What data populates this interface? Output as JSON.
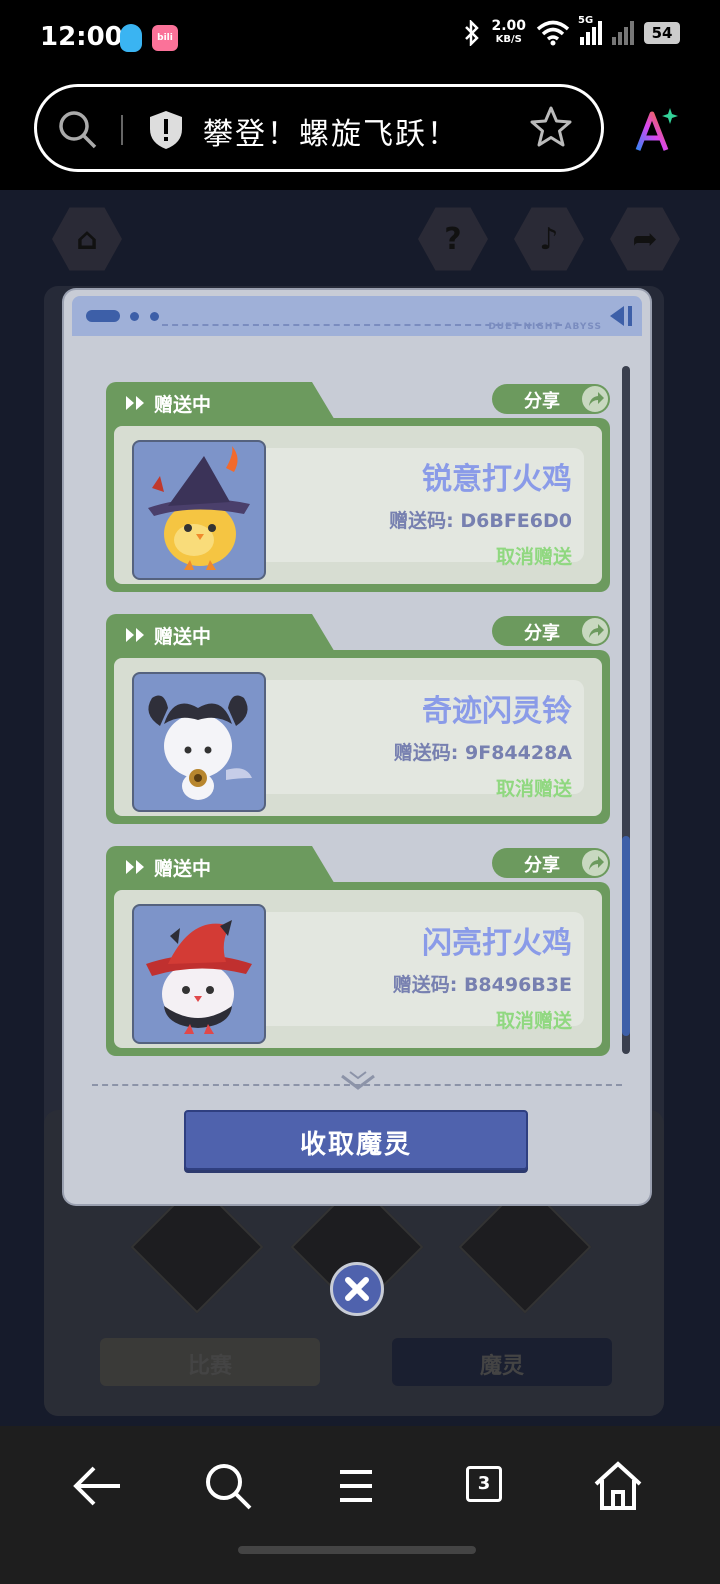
{
  "status_bar": {
    "time": "12:00",
    "net_speed_value": "2.00",
    "net_speed_unit": "KB/S",
    "network_type": "5G",
    "battery": "54"
  },
  "browser": {
    "page_title": "攀登！螺旋飞跃！"
  },
  "game_background": {
    "tab_left": "比赛",
    "tab_right": "魔灵"
  },
  "modal": {
    "brand": "DUET NIGHT ABYSS",
    "cards": [
      {
        "status": "赠送中",
        "share_label": "分享",
        "pet_name": "锐意打火鸡",
        "code_label": "赠送码: D6BFE6D0",
        "action_label": "取消赠送"
      },
      {
        "status": "赠送中",
        "share_label": "分享",
        "pet_name": "奇迹闪灵铃",
        "code_label": "赠送码: 9F84428A",
        "action_label": "取消赠送"
      },
      {
        "status": "赠送中",
        "share_label": "分享",
        "pet_name": "闪亮打火鸡",
        "code_label": "赠送码: B8496B3E",
        "action_label": "取消赠送"
      }
    ],
    "collect_button": "收取魔灵"
  },
  "colors": {
    "card_green": "#6c9a5e",
    "accent_blue": "#4f62ad",
    "pet_name": "#8a9be8"
  }
}
